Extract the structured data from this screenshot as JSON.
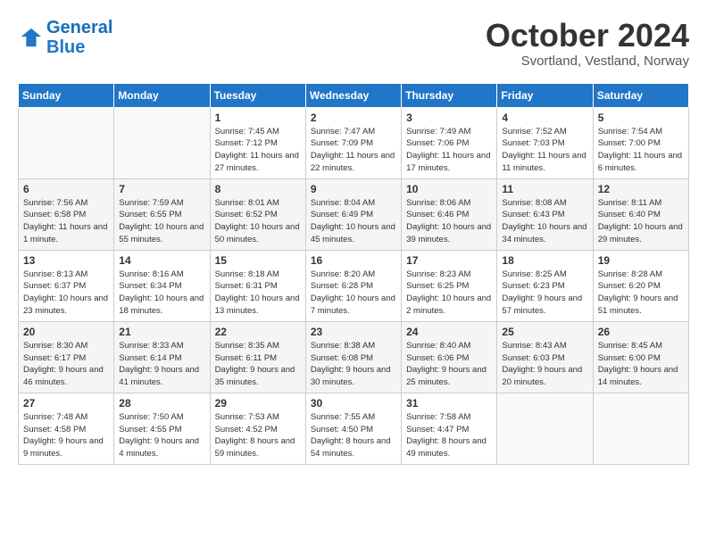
{
  "header": {
    "logo_line1": "General",
    "logo_line2": "Blue",
    "month": "October 2024",
    "location": "Svortland, Vestland, Norway"
  },
  "days_of_week": [
    "Sunday",
    "Monday",
    "Tuesday",
    "Wednesday",
    "Thursday",
    "Friday",
    "Saturday"
  ],
  "weeks": [
    [
      {
        "day": "",
        "info": ""
      },
      {
        "day": "",
        "info": ""
      },
      {
        "day": "1",
        "info": "Sunrise: 7:45 AM\nSunset: 7:12 PM\nDaylight: 11 hours\nand 27 minutes."
      },
      {
        "day": "2",
        "info": "Sunrise: 7:47 AM\nSunset: 7:09 PM\nDaylight: 11 hours\nand 22 minutes."
      },
      {
        "day": "3",
        "info": "Sunrise: 7:49 AM\nSunset: 7:06 PM\nDaylight: 11 hours\nand 17 minutes."
      },
      {
        "day": "4",
        "info": "Sunrise: 7:52 AM\nSunset: 7:03 PM\nDaylight: 11 hours\nand 11 minutes."
      },
      {
        "day": "5",
        "info": "Sunrise: 7:54 AM\nSunset: 7:00 PM\nDaylight: 11 hours\nand 6 minutes."
      }
    ],
    [
      {
        "day": "6",
        "info": "Sunrise: 7:56 AM\nSunset: 6:58 PM\nDaylight: 11 hours\nand 1 minute."
      },
      {
        "day": "7",
        "info": "Sunrise: 7:59 AM\nSunset: 6:55 PM\nDaylight: 10 hours\nand 55 minutes."
      },
      {
        "day": "8",
        "info": "Sunrise: 8:01 AM\nSunset: 6:52 PM\nDaylight: 10 hours\nand 50 minutes."
      },
      {
        "day": "9",
        "info": "Sunrise: 8:04 AM\nSunset: 6:49 PM\nDaylight: 10 hours\nand 45 minutes."
      },
      {
        "day": "10",
        "info": "Sunrise: 8:06 AM\nSunset: 6:46 PM\nDaylight: 10 hours\nand 39 minutes."
      },
      {
        "day": "11",
        "info": "Sunrise: 8:08 AM\nSunset: 6:43 PM\nDaylight: 10 hours\nand 34 minutes."
      },
      {
        "day": "12",
        "info": "Sunrise: 8:11 AM\nSunset: 6:40 PM\nDaylight: 10 hours\nand 29 minutes."
      }
    ],
    [
      {
        "day": "13",
        "info": "Sunrise: 8:13 AM\nSunset: 6:37 PM\nDaylight: 10 hours\nand 23 minutes."
      },
      {
        "day": "14",
        "info": "Sunrise: 8:16 AM\nSunset: 6:34 PM\nDaylight: 10 hours\nand 18 minutes."
      },
      {
        "day": "15",
        "info": "Sunrise: 8:18 AM\nSunset: 6:31 PM\nDaylight: 10 hours\nand 13 minutes."
      },
      {
        "day": "16",
        "info": "Sunrise: 8:20 AM\nSunset: 6:28 PM\nDaylight: 10 hours\nand 7 minutes."
      },
      {
        "day": "17",
        "info": "Sunrise: 8:23 AM\nSunset: 6:25 PM\nDaylight: 10 hours\nand 2 minutes."
      },
      {
        "day": "18",
        "info": "Sunrise: 8:25 AM\nSunset: 6:23 PM\nDaylight: 9 hours\nand 57 minutes."
      },
      {
        "day": "19",
        "info": "Sunrise: 8:28 AM\nSunset: 6:20 PM\nDaylight: 9 hours\nand 51 minutes."
      }
    ],
    [
      {
        "day": "20",
        "info": "Sunrise: 8:30 AM\nSunset: 6:17 PM\nDaylight: 9 hours\nand 46 minutes."
      },
      {
        "day": "21",
        "info": "Sunrise: 8:33 AM\nSunset: 6:14 PM\nDaylight: 9 hours\nand 41 minutes."
      },
      {
        "day": "22",
        "info": "Sunrise: 8:35 AM\nSunset: 6:11 PM\nDaylight: 9 hours\nand 35 minutes."
      },
      {
        "day": "23",
        "info": "Sunrise: 8:38 AM\nSunset: 6:08 PM\nDaylight: 9 hours\nand 30 minutes."
      },
      {
        "day": "24",
        "info": "Sunrise: 8:40 AM\nSunset: 6:06 PM\nDaylight: 9 hours\nand 25 minutes."
      },
      {
        "day": "25",
        "info": "Sunrise: 8:43 AM\nSunset: 6:03 PM\nDaylight: 9 hours\nand 20 minutes."
      },
      {
        "day": "26",
        "info": "Sunrise: 8:45 AM\nSunset: 6:00 PM\nDaylight: 9 hours\nand 14 minutes."
      }
    ],
    [
      {
        "day": "27",
        "info": "Sunrise: 7:48 AM\nSunset: 4:58 PM\nDaylight: 9 hours\nand 9 minutes."
      },
      {
        "day": "28",
        "info": "Sunrise: 7:50 AM\nSunset: 4:55 PM\nDaylight: 9 hours\nand 4 minutes."
      },
      {
        "day": "29",
        "info": "Sunrise: 7:53 AM\nSunset: 4:52 PM\nDaylight: 8 hours\nand 59 minutes."
      },
      {
        "day": "30",
        "info": "Sunrise: 7:55 AM\nSunset: 4:50 PM\nDaylight: 8 hours\nand 54 minutes."
      },
      {
        "day": "31",
        "info": "Sunrise: 7:58 AM\nSunset: 4:47 PM\nDaylight: 8 hours\nand 49 minutes."
      },
      {
        "day": "",
        "info": ""
      },
      {
        "day": "",
        "info": ""
      }
    ]
  ]
}
